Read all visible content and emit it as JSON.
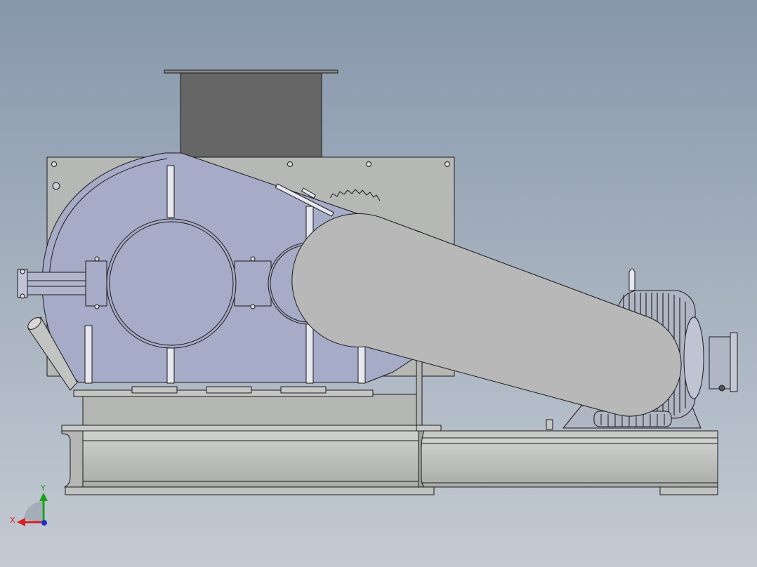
{
  "viewport": {
    "background_top": "#8797ab",
    "background_bottom": "#c3cad3"
  },
  "model": {
    "colors": {
      "housing": "#a6abc7",
      "frame": "#b3b6b3",
      "hopper": "#666666",
      "belt_guard": "#b8b8b8",
      "motor": "#b0b5c4",
      "outline": "#1a1a1a"
    }
  },
  "triad": {
    "x_label": "X",
    "y_label": "Y",
    "x_color": "#d81e1e",
    "y_color": "#18a018",
    "z_color": "#1e2ed0"
  }
}
